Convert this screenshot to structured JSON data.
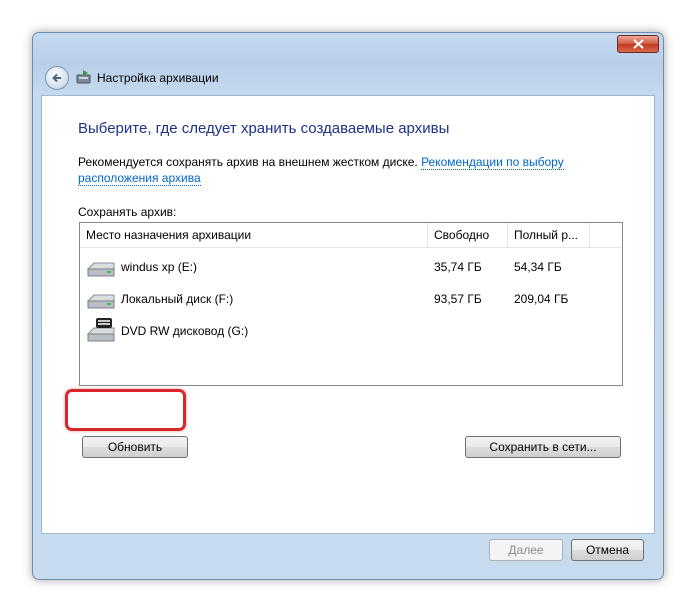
{
  "window": {
    "title": "Настройка архивации"
  },
  "main": {
    "heading": "Выберите, где следует хранить создаваемые архивы",
    "recommendation_text": "Рекомендуется сохранять архив на внешнем жестком диске.",
    "recommendation_link": "Рекомендации по выбору расположения архива",
    "save_label": "Сохранять архив:"
  },
  "table": {
    "columns": [
      "Место назначения архивации",
      "Свободно",
      "Полный р..."
    ],
    "rows": [
      {
        "name": "windus xp (E:)",
        "free": "35,74 ГБ",
        "total": "54,34 ГБ",
        "icon": "hard-drive-icon"
      },
      {
        "name": "Локальный диск (F:)",
        "free": "93,57 ГБ",
        "total": "209,04 ГБ",
        "icon": "hard-drive-icon"
      },
      {
        "name": "DVD RW дисковод (G:)",
        "free": "",
        "total": "",
        "icon": "dvd-drive-icon"
      }
    ]
  },
  "buttons": {
    "refresh": "Обновить",
    "save_network": "Сохранить в сети...",
    "next": "Далее",
    "cancel": "Отмена"
  },
  "colors": {
    "heading": "#1e3287",
    "link": "#0066cc",
    "highlight": "#d9262a"
  }
}
